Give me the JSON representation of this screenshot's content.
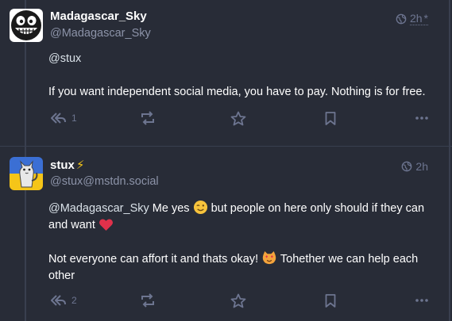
{
  "posts": [
    {
      "display_name": "Madagascar_Sky",
      "handle": "@Madagascar_Sky",
      "time": "2h",
      "time_marker": "*",
      "mention": "@stux",
      "body": "If you want independent social media, you have to pay. Nothing is for free.",
      "reply_count": "1",
      "avatar_icon": "grinning-face-avatar"
    },
    {
      "display_name": "stux",
      "name_emoji": "⚡",
      "handle": "@stux@mstdn.social",
      "time": "2h",
      "mention": "@Madagascar_Sky",
      "line1_a": " Me yes ",
      "line1_b": " but people on here only should if they can and want ",
      "line2_a": "Not everyone can affort it and thats okay! ",
      "line2_b": " Tohether we can help each other",
      "reply_count": "2",
      "avatar_icon": "cat-on-flag-avatar"
    }
  ],
  "colors": {
    "background": "#282c37",
    "muted": "#6d7590",
    "handle": "#8c93a8",
    "border": "#393f4f"
  }
}
